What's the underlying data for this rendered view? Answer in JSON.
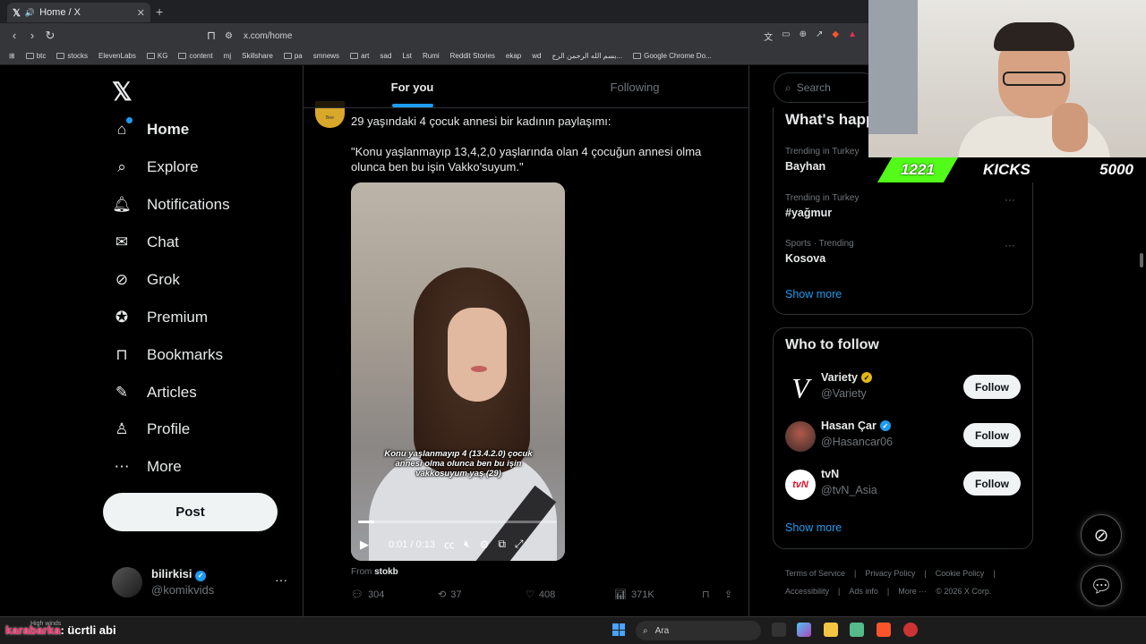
{
  "browser": {
    "tab_title": "Home / X",
    "url": "x.com/home",
    "bookmarks": [
      "btc",
      "stocks",
      "ElevenLabs",
      "KG",
      "content",
      "mj",
      "Skillshare",
      "pa",
      "smnews",
      "art",
      "sad",
      "Lst",
      "Rumi",
      "Reddit Stories",
      "ekap",
      "wd",
      "بسم الله الرحمن الرح...",
      "Google Chrome Do..."
    ]
  },
  "nav": {
    "items": [
      "Home",
      "Explore",
      "Notifications",
      "Chat",
      "Grok",
      "Premium",
      "Bookmarks",
      "Articles",
      "Profile",
      "More"
    ],
    "post_label": "Post",
    "account": {
      "name": "bilirkisi",
      "handle": "@komikvids"
    }
  },
  "feed": {
    "tabs": [
      "For you",
      "Following"
    ],
    "tweet": {
      "line1": "29 yaşındaki 4 çocuk annesi bir kadının paylaşımı:",
      "line2": "\"Konu yaşlanmayıp 13,4,2,0 yaşlarında olan 4 çocuğun annesi olma olunca ben bu işin Vakko'suyum.\"",
      "video_caption": "Konu yaşlanmayıp 4 (13.4.2.0) çocuk annesi olma olunca ben bu işin vakkosuyum yaş (29)",
      "video_time": "0:01 / 0:13",
      "video_progress": 0.08,
      "from_label": "From",
      "from_user": "stokb",
      "replies": "304",
      "reposts": "37",
      "likes": "408",
      "views": "371K"
    }
  },
  "sidebar": {
    "search_placeholder": "Search",
    "trends_title": "What's happ",
    "trends": [
      {
        "category": "Trending in Turkey",
        "name": "Bayhan"
      },
      {
        "category": "Trending in Turkey",
        "name": "#yağmur"
      },
      {
        "category": "Sports · Trending",
        "name": "Kosova"
      }
    ],
    "show_more": "Show more",
    "who_to_follow_title": "Who to follow",
    "follow": [
      {
        "name": "Variety",
        "handle": "@Variety",
        "button": "Follow"
      },
      {
        "name": "Hasan Çar",
        "handle": "@Hasancar06",
        "button": "Follow"
      },
      {
        "name": "tvN",
        "handle": "@tvN_Asia",
        "button": "Follow"
      }
    ],
    "footer": [
      "Terms of Service",
      "|",
      "Privacy Policy",
      "|",
      "Cookie Policy",
      "|",
      "Accessibility",
      "|",
      "Ads info",
      "|",
      "More ···",
      "© 2026 X Corp."
    ]
  },
  "overlay": {
    "kicks_count": "1221",
    "kicks_label": "KICKS",
    "kicks_goal": "5000"
  },
  "taskbar": {
    "chat_user": "karabarka",
    "chat_msg": ": ücrtli abi",
    "weather": "High winds",
    "search_label": "Ara"
  },
  "colors": {
    "accent": "#1d9bf0",
    "kick_green": "#53fc18"
  }
}
